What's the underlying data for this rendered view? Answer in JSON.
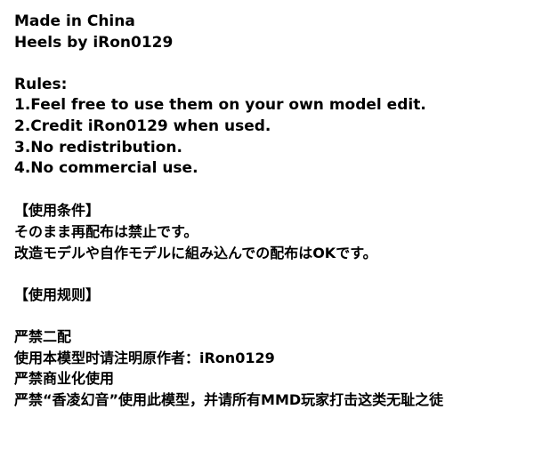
{
  "header": {
    "made_in": "Made in China",
    "credit": "Heels by iRon0129"
  },
  "rules": {
    "title": "Rules:",
    "items": [
      "1.Feel free to use them on your own model edit.",
      "2.Credit iRon0129 when used.",
      "3.No redistribution.",
      "4.No commercial use."
    ]
  },
  "japanese": {
    "title": "【使用条件】",
    "lines": [
      "そのまま再配布は禁止です。",
      "改造モデルや自作モデルに組み込んでの配布はOKです。"
    ]
  },
  "chinese": {
    "title": "【使用规则】",
    "lines": [
      "严禁二配",
      "使用本模型时请注明原作者：iRon0129",
      "严禁商业化使用",
      "严禁“香凌幻音”使用此模型，并请所有MMD玩家打击这类无耻之徒"
    ]
  }
}
